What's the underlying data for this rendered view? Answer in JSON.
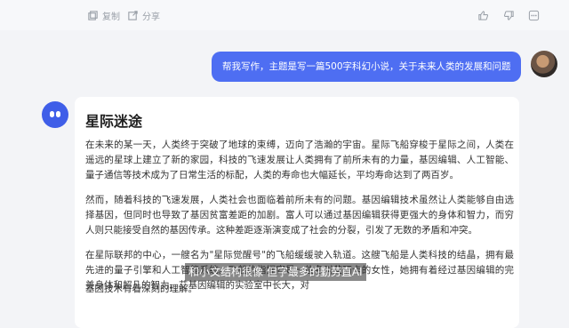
{
  "toolbar": {
    "copy_label": "复制",
    "share_label": "分享",
    "like_icon": "thumbs-up-icon",
    "dislike_icon": "thumbs-down-icon",
    "more_icon": "more-icon"
  },
  "user_message": "帮我写作，主题是写一篇500字科幻小说，关于未来人类的发展和问题",
  "response": {
    "title": "星际迷途",
    "paragraphs": [
      "在未来的某一天，人类终于突破了地球的束缚，迈向了浩瀚的宇宙。星际飞船穿梭于星际之间，人类在遥远的星球上建立了新的家园，科技的飞速发展让人类拥有了前所未有的力量，基因编辑、人工智能、量子通信等技术成为了日常生活的标配，人类的寿命也大幅延长，平均寿命达到了两百岁。",
      "然而，随着科技的飞速发展，人类社会也面临着前所未有的问题。基因编辑技术虽然让人类能够自由选择基因，但同时也导致了基因贫富差距的加剧。富人可以通过基因编辑获得更强大的身体和智力，而穷人则只能接受自然的基因传承。这种差距逐渐演变成了社会的分裂，引发了无数的矛盾和冲突。",
      "在星际联邦的中心，一艘名为\"星际觉醒号\"的飞船缓缓驶入轨道。这艘飞船是人类科技的结晶，拥有最先进的量子引擎和人工智能系统。飞船的指挥官是一位名叫艾丽卡的女性，她拥有着经过基因编辑的完美身体和超凡的智力。艾",
      "基因技术有着深刻的理解。"
    ],
    "para3_tail": "基因编辑的实验室中长大，对"
  },
  "subtitle": "和小文结构很像 但字最多的勤劳直AI",
  "colors": {
    "accent": "#4e6ef2",
    "background": "#f3f4f7",
    "card": "#ffffff"
  }
}
